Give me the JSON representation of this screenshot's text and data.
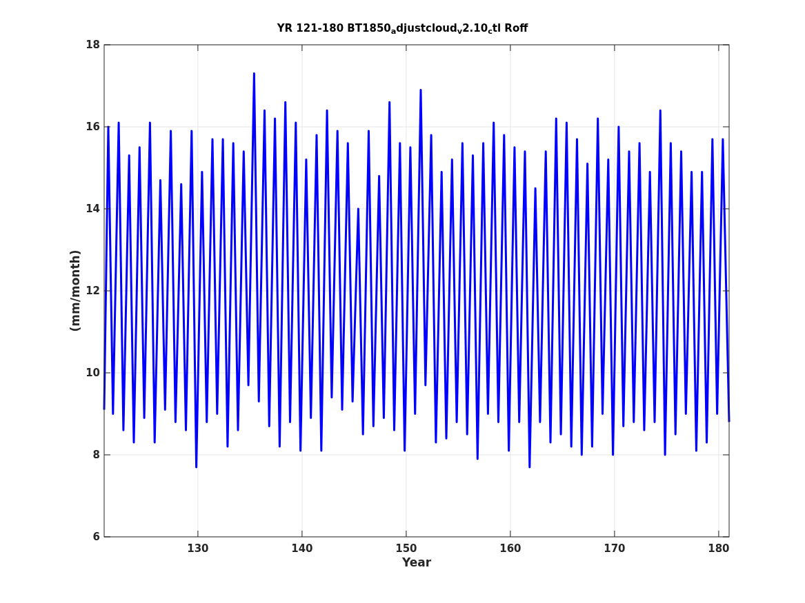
{
  "figure": {
    "chart_data": {
      "type": "line",
      "title": "YR 121-180 BT1850$_{a}$djustcloud$_{v}$2.10$_{c}$tl Roff",
      "xlabel": "Year",
      "ylabel": "(mm/month)",
      "xlim": [
        121,
        181
      ],
      "ylim": [
        6,
        18
      ],
      "xticks": [
        130,
        140,
        150,
        160,
        170,
        180
      ],
      "yticks": [
        6,
        8,
        10,
        12,
        14,
        16,
        18
      ],
      "grid": true,
      "x": [
        121,
        121.4,
        121.85,
        122.4,
        122.85,
        123.4,
        123.85,
        124.4,
        124.85,
        125.4,
        125.85,
        126.4,
        126.85,
        127.4,
        127.85,
        128.4,
        128.85,
        129.4,
        129.85,
        130.4,
        130.85,
        131.4,
        131.85,
        132.4,
        132.85,
        133.4,
        133.85,
        134.4,
        134.85,
        135.4,
        135.85,
        136.4,
        136.85,
        137.4,
        137.85,
        138.4,
        138.85,
        139.4,
        139.85,
        140.4,
        140.85,
        141.4,
        141.85,
        142.4,
        142.85,
        143.4,
        143.85,
        144.4,
        144.85,
        145.4,
        145.85,
        146.4,
        146.85,
        147.4,
        147.85,
        148.4,
        148.85,
        149.4,
        149.85,
        150.4,
        150.85,
        151.4,
        151.85,
        152.4,
        152.85,
        153.4,
        153.85,
        154.4,
        154.85,
        155.4,
        155.85,
        156.4,
        156.85,
        157.4,
        157.85,
        158.4,
        158.85,
        159.4,
        159.85,
        160.4,
        160.85,
        161.4,
        161.85,
        162.4,
        162.85,
        163.4,
        163.85,
        164.4,
        164.85,
        165.4,
        165.85,
        166.4,
        166.85,
        167.4,
        167.85,
        168.4,
        168.85,
        169.4,
        169.85,
        170.4,
        170.85,
        171.4,
        171.85,
        172.4,
        172.85,
        173.4,
        173.85,
        174.4,
        174.85,
        175.4,
        175.85,
        176.4,
        176.85,
        177.4,
        177.85,
        178.4,
        178.85,
        179.4,
        179.85,
        180.4,
        181
      ],
      "series": [
        {
          "color": "#0000ff",
          "values": [
            9.1,
            16.0,
            9.0,
            16.1,
            8.6,
            15.3,
            8.3,
            15.5,
            8.9,
            16.1,
            8.3,
            14.7,
            9.1,
            15.9,
            8.8,
            14.6,
            8.6,
            15.9,
            7.7,
            14.9,
            8.8,
            15.7,
            9.0,
            15.7,
            8.2,
            15.6,
            8.6,
            15.4,
            9.7,
            17.3,
            9.3,
            16.4,
            8.7,
            16.2,
            8.2,
            16.6,
            8.8,
            16.1,
            8.1,
            15.2,
            8.9,
            15.8,
            8.1,
            16.4,
            9.4,
            15.9,
            9.1,
            15.6,
            9.3,
            14.0,
            8.5,
            15.9,
            8.7,
            14.8,
            8.9,
            16.6,
            8.6,
            15.6,
            8.1,
            15.5,
            9.0,
            16.9,
            9.7,
            15.8,
            8.3,
            14.9,
            8.4,
            15.2,
            8.8,
            15.6,
            8.5,
            15.3,
            7.9,
            15.6,
            9.0,
            16.1,
            8.8,
            15.8,
            8.1,
            15.5,
            8.8,
            15.4,
            7.7,
            14.5,
            8.8,
            15.4,
            8.3,
            16.2,
            8.5,
            16.1,
            8.2,
            15.7,
            8.0,
            15.1,
            8.2,
            16.2,
            9.0,
            15.2,
            8.0,
            16.0,
            8.7,
            15.4,
            8.8,
            15.6,
            8.6,
            14.9,
            8.8,
            16.4,
            8.0,
            15.6,
            8.5,
            15.4,
            9.0,
            14.9,
            8.1,
            14.9,
            8.3,
            15.7,
            9.0,
            15.7,
            8.8
          ]
        }
      ]
    }
  }
}
